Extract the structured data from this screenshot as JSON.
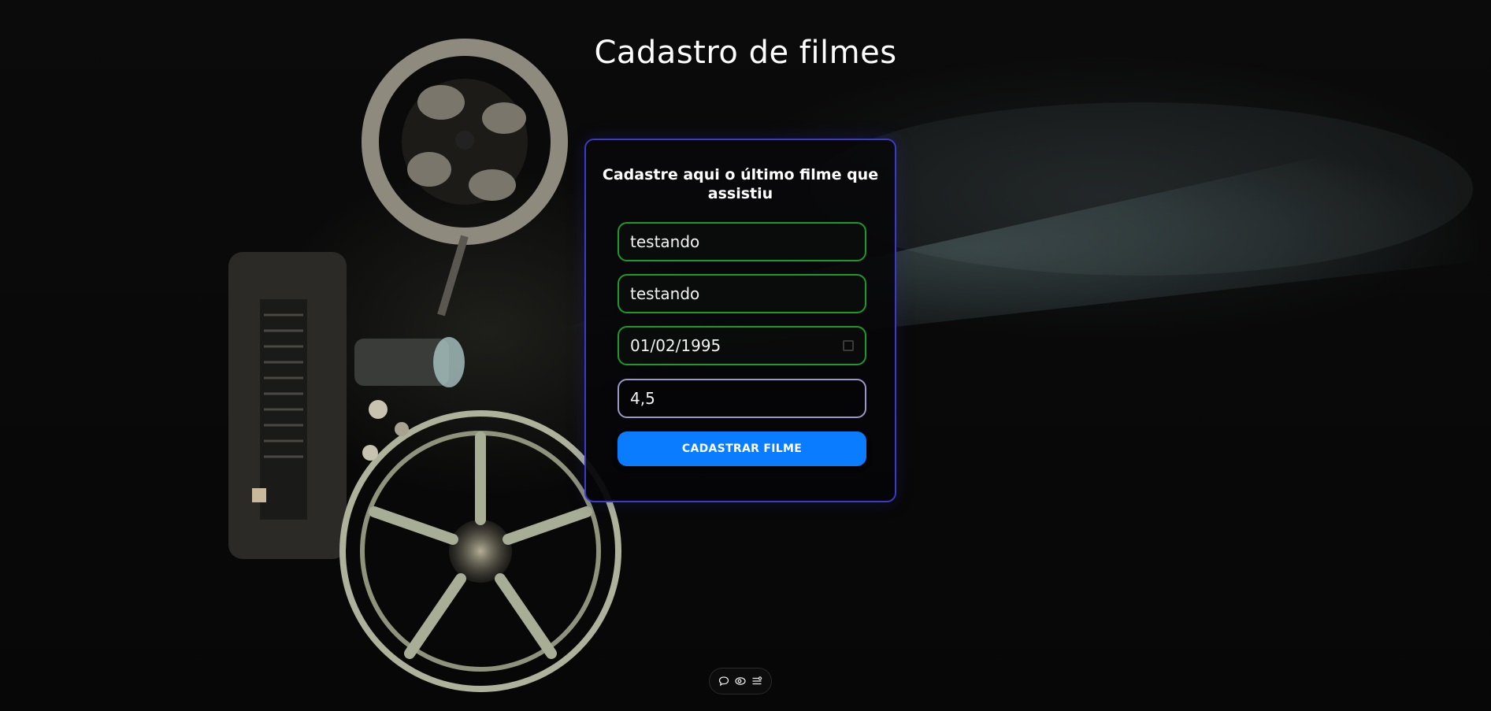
{
  "page": {
    "title": "Cadastro de filmes"
  },
  "form": {
    "heading": "Cadastre aqui o último filme que assistiu",
    "fields": {
      "title_value": "testando",
      "genre_value": "testando",
      "date_value": "01/02/1995",
      "rating_value": "4,5"
    },
    "submit_label": "CADASTRAR FILME"
  },
  "toolbar": {
    "icons": [
      "comment-icon",
      "eye-icon",
      "list-settings-icon"
    ]
  },
  "colors": {
    "card_border": "#3d39c9",
    "field_valid_border": "#1f9a2a",
    "field_focus_border": "#9b98c8",
    "button_bg": "#0a7cff",
    "background": "#050505"
  }
}
